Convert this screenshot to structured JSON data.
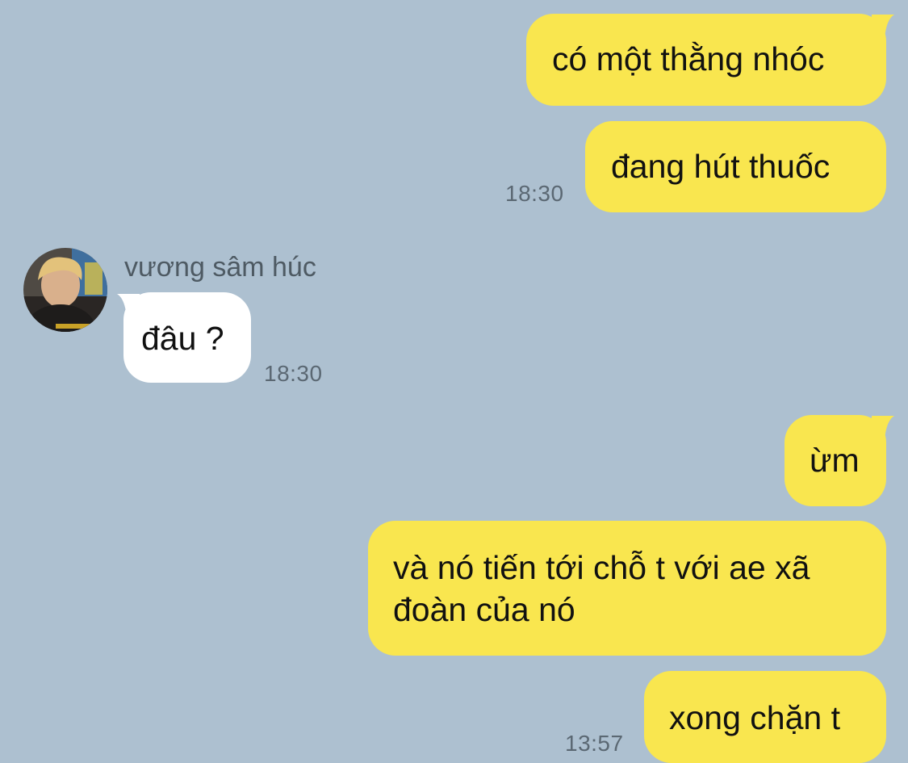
{
  "colors": {
    "background": "#adc0d0",
    "outgoing_bubble": "#f9e64f",
    "incoming_bubble": "#ffffff",
    "timestamp": "#5b6873"
  },
  "messages": [
    {
      "direction": "out",
      "text": "có một thằng nhóc"
    },
    {
      "direction": "out",
      "text": "đang hút thuốc",
      "time": "18:30"
    },
    {
      "direction": "in",
      "sender": "vương sâm húc",
      "avatar": "profile-photo",
      "text": "đâu ?",
      "time": "18:30"
    },
    {
      "direction": "out",
      "text": "ừm"
    },
    {
      "direction": "out",
      "text_lines": [
        "và nó tiến tới chỗ t với ae xã",
        "đoàn của nó"
      ]
    },
    {
      "direction": "out",
      "text": "xong chặn t",
      "time": "13:57"
    }
  ]
}
